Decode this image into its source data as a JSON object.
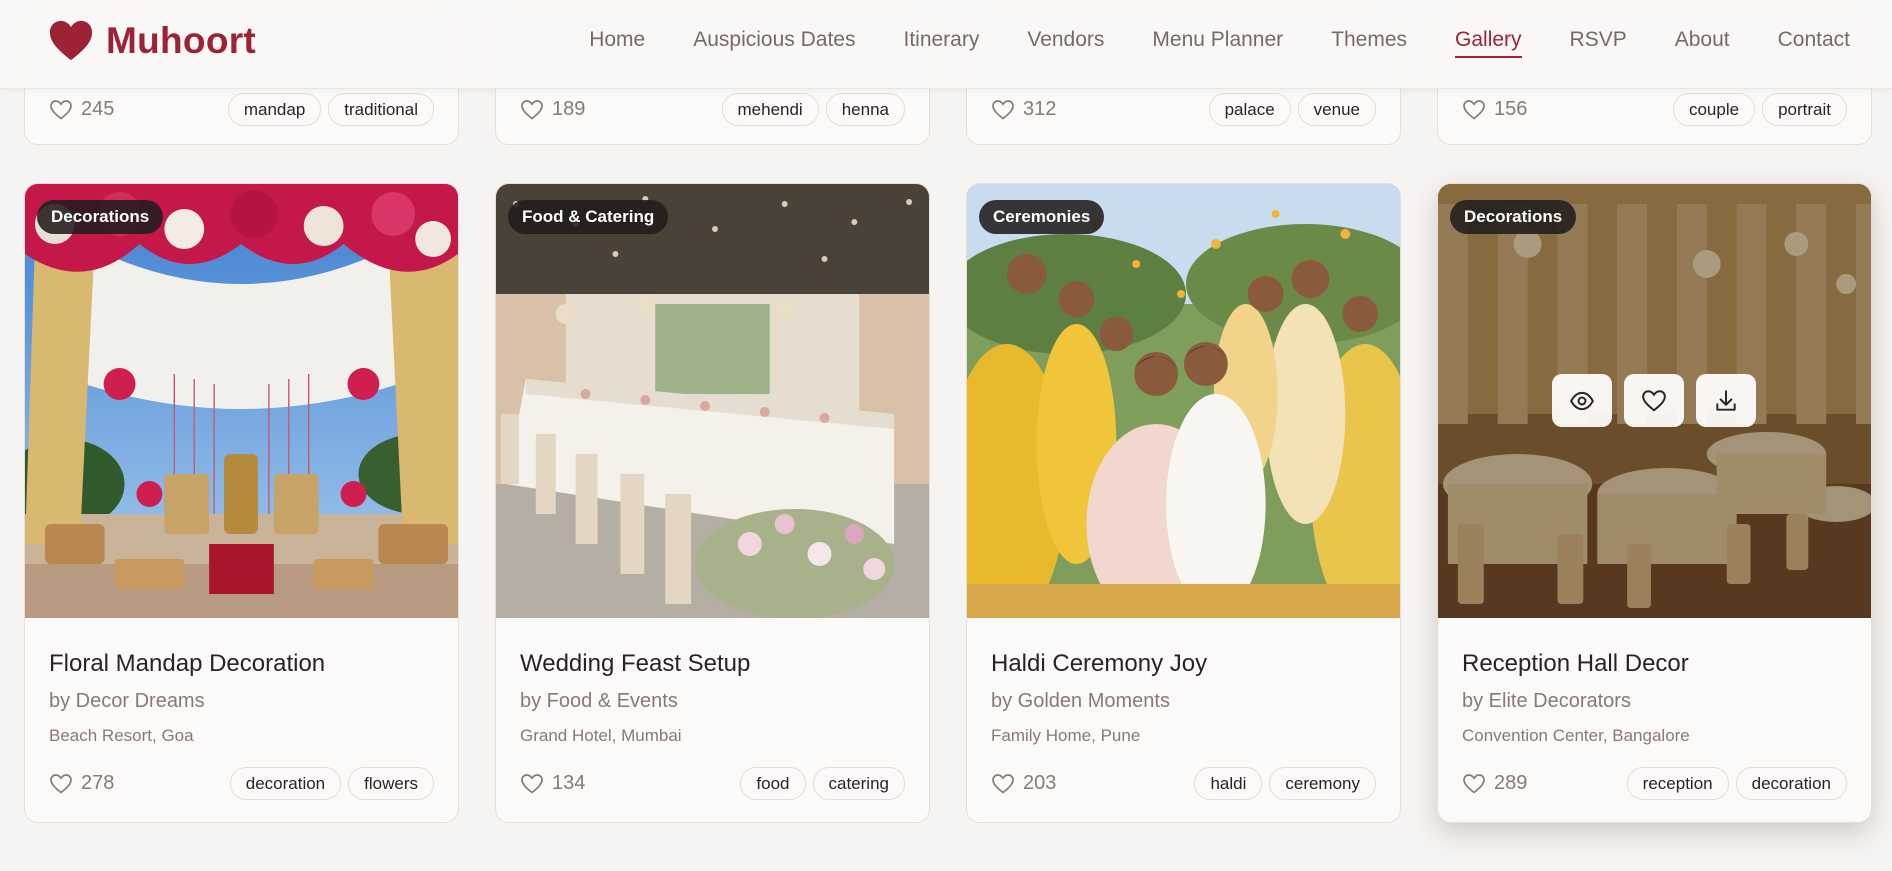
{
  "brand": {
    "name": "Muhoort",
    "color": "#9b2335"
  },
  "nav": {
    "items": [
      {
        "label": "Home"
      },
      {
        "label": "Auspicious Dates"
      },
      {
        "label": "Itinerary"
      },
      {
        "label": "Vendors"
      },
      {
        "label": "Menu Planner"
      },
      {
        "label": "Themes"
      },
      {
        "label": "Gallery",
        "active": true
      },
      {
        "label": "RSVP"
      },
      {
        "label": "About"
      },
      {
        "label": "Contact"
      }
    ]
  },
  "top_row": [
    {
      "likes": "245",
      "tags": [
        "mandap",
        "traditional"
      ]
    },
    {
      "likes": "189",
      "tags": [
        "mehendi",
        "henna"
      ]
    },
    {
      "likes": "312",
      "tags": [
        "palace",
        "venue"
      ]
    },
    {
      "likes": "156",
      "tags": [
        "couple",
        "portrait"
      ]
    }
  ],
  "cards": [
    {
      "category": "Decorations",
      "title": "Floral Mandap Decoration",
      "author": "by Decor Dreams",
      "location": "Beach Resort, Goa",
      "likes": "278",
      "tags": [
        "decoration",
        "flowers"
      ]
    },
    {
      "category": "Food & Catering",
      "title": "Wedding Feast Setup",
      "author": "by Food & Events",
      "location": "Grand Hotel, Mumbai",
      "likes": "134",
      "tags": [
        "food",
        "catering"
      ]
    },
    {
      "category": "Ceremonies",
      "title": "Haldi Ceremony Joy",
      "author": "by Golden Moments",
      "location": "Family Home, Pune",
      "likes": "203",
      "tags": [
        "haldi",
        "ceremony"
      ]
    },
    {
      "category": "Decorations",
      "title": "Reception Hall Decor",
      "author": "by Elite Decorators",
      "location": "Convention Center, Bangalore",
      "likes": "289",
      "tags": [
        "reception",
        "decoration"
      ]
    }
  ]
}
